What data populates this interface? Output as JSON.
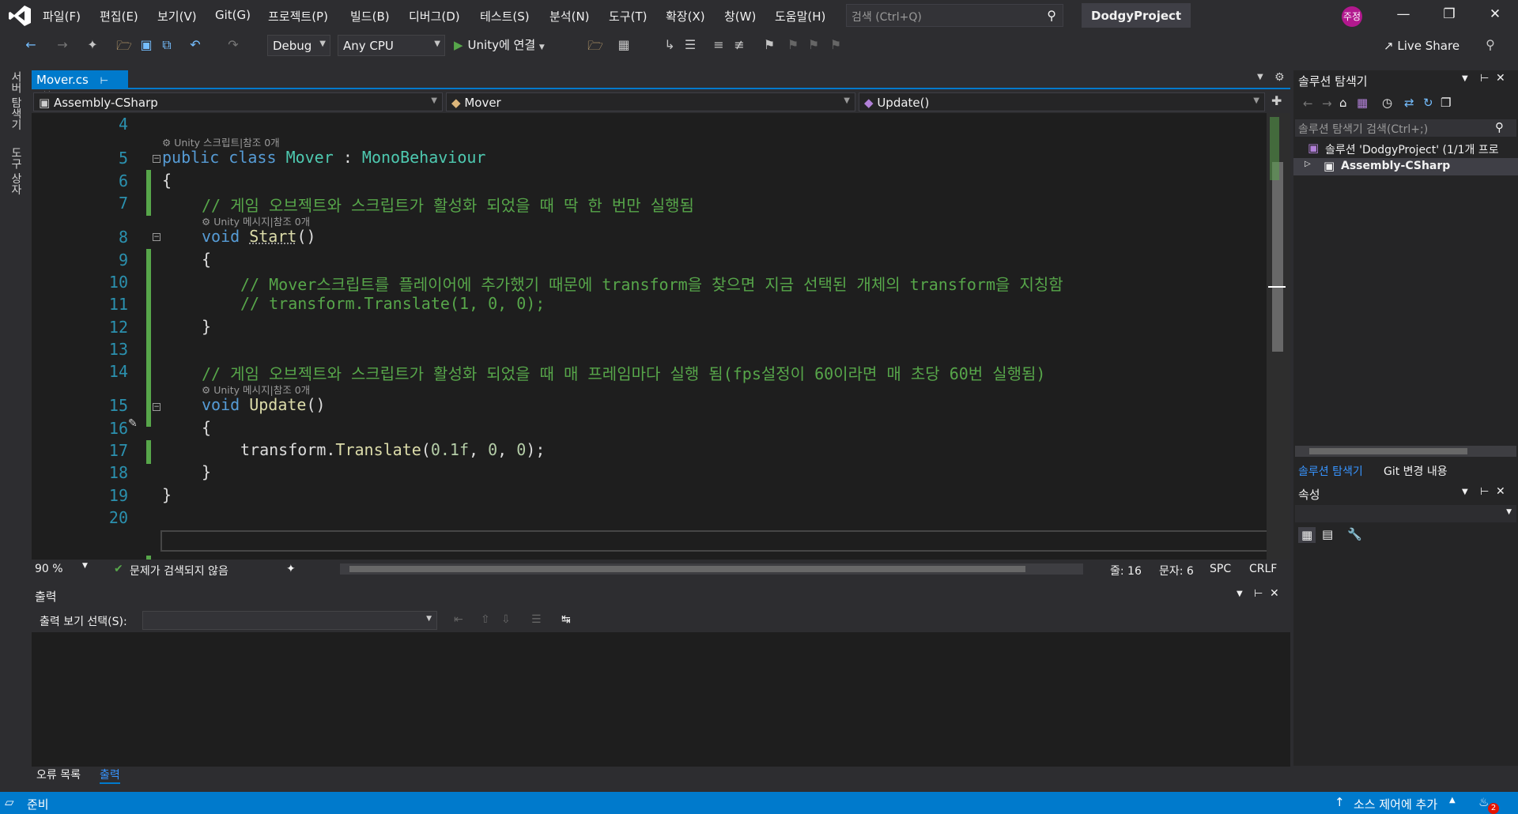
{
  "menu": {
    "items": [
      "파일(F)",
      "편집(E)",
      "보기(V)",
      "Git(G)",
      "프로젝트(P)",
      "빌드(B)",
      "디버그(D)",
      "테스트(S)",
      "분석(N)",
      "도구(T)",
      "확장(X)",
      "창(W)",
      "도움말(H)"
    ],
    "search_placeholder": "검색 (Ctrl+Q)",
    "project_name": "DodgyProject",
    "avatar_text": "주정"
  },
  "toolbar": {
    "config": "Debug",
    "platform": "Any CPU",
    "run_label": "Unity에 연결",
    "liveshare": "Live Share"
  },
  "side_tabs": [
    "서버 탐색기",
    "도구 상자"
  ],
  "editor": {
    "tab": "Mover.cs",
    "nav_project": "Assembly-CSharp",
    "nav_class": "Mover",
    "nav_member": "Update()",
    "lines": [
      {
        "n": "4"
      },
      {
        "n": "5",
        "lens": "Unity 스크립트|참조 0개"
      },
      {
        "n": "6"
      },
      {
        "n": "7",
        "c": "// 게임 오브젝트와 스크립트가 활성화 되었을 때 딱 한 번만 실행됨"
      },
      {
        "n": "8",
        "lens": "Unity 메시지|참조 0개"
      },
      {
        "n": "9"
      },
      {
        "n": "10",
        "c": "// Mover스크립트를 플레이어에 추가했기 때문에 transform을 찾으면 지금 선택된 개체의 transform을 지칭함"
      },
      {
        "n": "11",
        "c": "// transform.Translate(1, 0, 0);"
      },
      {
        "n": "12"
      },
      {
        "n": "13"
      },
      {
        "n": "14",
        "c": "// 게임 오브젝트와 스크립트가 활성화 되었을 때 매 프레임마다 실행 됨(fps설정이 60이라면 매 초당 60번 실행됨)"
      },
      {
        "n": "15",
        "lens": "Unity 메시지|참조 0개"
      },
      {
        "n": "16"
      },
      {
        "n": "17"
      },
      {
        "n": "18"
      },
      {
        "n": "19"
      },
      {
        "n": "20"
      }
    ],
    "tokens": {
      "public": "public",
      "class": "class",
      "classname": "Mover",
      "colon": ":",
      "base": "MonoBehaviour",
      "open": "{",
      "close": "}",
      "void": "void",
      "start": "Start",
      "update": "Update",
      "parens": "()",
      "transform": "transform",
      "dot": ".",
      "translate": "Translate",
      "arg1": "0.1f",
      "sep": ", ",
      "zero": "0",
      "end": ");",
      "lp": "("
    }
  },
  "status_line": {
    "zoom": "90 %",
    "issues": "문제가 검색되지 않음",
    "line": "줄: 16",
    "col": "문자: 6",
    "spc": "SPC",
    "eol": "CRLF"
  },
  "output": {
    "title": "출력",
    "show_label": "출력 보기 선택(S):",
    "tabs": [
      "오류 목록",
      "출력"
    ]
  },
  "solution": {
    "title": "솔루션 탐색기",
    "search_placeholder": "솔루션 탐색기 검색(Ctrl+;)",
    "root": "솔루션 'DodgyProject' (1/1개 프로",
    "child": "Assembly-CSharp",
    "tabs": [
      "솔루션 탐색기",
      "Git 변경 내용"
    ]
  },
  "properties": {
    "title": "속성"
  },
  "statusbar": {
    "ready": "준비",
    "source_control": "소스 제어에 추가",
    "notifications": "2"
  },
  "colors": {
    "accent": "#007acc",
    "keyword": "#569cd6",
    "type": "#4ec9b0",
    "comment": "#57a64a",
    "line_number": "#2b91af"
  }
}
